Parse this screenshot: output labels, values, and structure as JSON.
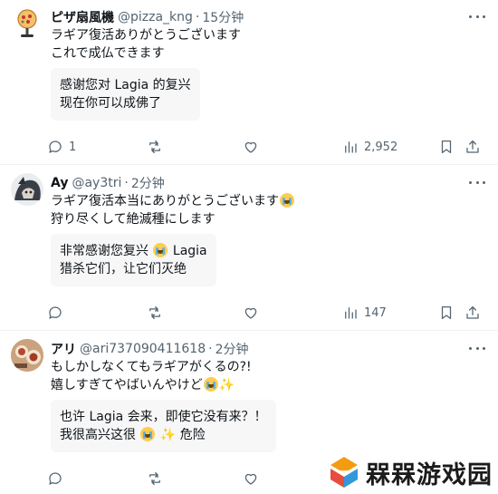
{
  "tweets": [
    {
      "display_name": "ピザ扇風機",
      "handle": "@pizza_kng",
      "separator": "·",
      "time": "15分钟",
      "lines": [
        "ラギア復活ありがとうございます",
        "これで成仏できます"
      ],
      "translation": [
        "感谢您对 Lagia 的复兴",
        "现在你可以成佛了"
      ],
      "replies": "1",
      "retweets": "",
      "likes": "",
      "views": "2,952"
    },
    {
      "display_name": "Ay",
      "handle": "@ay3tri",
      "separator": "·",
      "time": "2分钟",
      "lines": [
        "ラギア復活本当にありがとうございます",
        "狩り尽くして絶滅種にします"
      ],
      "translation": [
        "非常感谢您复兴",
        "Lagia",
        "猎杀它们，让它们灭绝"
      ],
      "replies": "",
      "retweets": "",
      "likes": "",
      "views": "147"
    },
    {
      "display_name": "アリ",
      "handle": "@ari737090411618",
      "separator": "·",
      "time": "2分钟",
      "lines": [
        "もしかしなくてもラギアがくるの?!",
        "嬉しすぎてやばいんやけど"
      ],
      "translation": [
        "也许 Lagia 会来，即使它没有来？！",
        "我很高兴这很",
        "危险"
      ],
      "replies": "",
      "retweets": "",
      "likes": "",
      "views": ""
    }
  ],
  "icons": {
    "reply": "reply-icon",
    "retweet": "retweet-icon",
    "like": "like-icon",
    "views": "views-icon",
    "bookmark": "bookmark-icon",
    "share": "share-icon",
    "more": "more-icon",
    "emoji_cry": "loudly-crying-face-emoji",
    "emoji_sparkles": "sparkles-emoji"
  },
  "watermark": {
    "text": "槑槑游戏园"
  },
  "colors": {
    "text_primary": "#0f1419",
    "text_secondary": "#536471",
    "translation_bg": "#f7f7f7",
    "divider": "#eff3f4"
  }
}
